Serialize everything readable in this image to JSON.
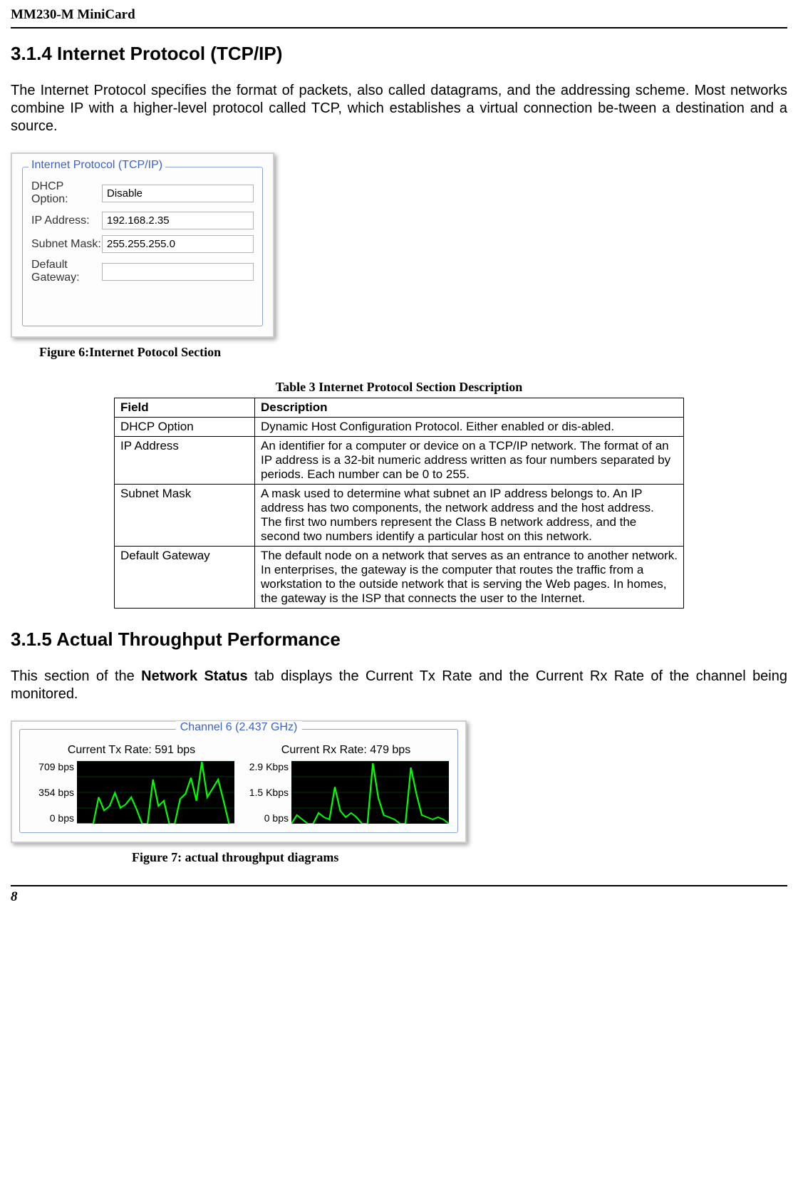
{
  "header": {
    "title": "MM230-M MiniCard"
  },
  "section314": {
    "heading": "3.1.4 Internet Protocol (TCP/IP)",
    "para": "The Internet Protocol specifies the format of packets, also called datagrams, and the addressing scheme. Most networks combine IP with a higher-level protocol called TCP, which establishes a virtual connection be-tween a destination and a source."
  },
  "tcpip_panel": {
    "group_title": "Internet Protocol (TCP/IP)",
    "rows": [
      {
        "label": "DHCP Option:",
        "value": "Disable"
      },
      {
        "label": "IP Address:",
        "value": "192.168.2.35"
      },
      {
        "label": "Subnet Mask:",
        "value": "255.255.255.0"
      },
      {
        "label": "Default Gateway:",
        "value": ""
      }
    ]
  },
  "figure6_caption": "Figure 6:Internet Potocol Section",
  "table3": {
    "caption": "Table 3 Internet Protocol Section Description",
    "headers": [
      "Field",
      "Description"
    ],
    "rows": [
      {
        "field": "DHCP Option",
        "desc": "Dynamic Host Configuration Protocol. Either enabled or dis-abled."
      },
      {
        "field": "IP Address",
        "desc": "An identifier for a computer or device on a TCP/IP network. The format of an IP address\nis a 32-bit numeric address written as four numbers separated by periods. Each number\ncan be 0 to 255."
      },
      {
        "field": "Subnet Mask",
        "desc": "A mask used to determine what subnet an IP address belongs to. An IP address has two\ncomponents, the network address and the host address. The first two numbers represent the Class B network address, and the second two numbers identify a particular host on\nthis network."
      },
      {
        "field": "Default Gateway",
        "desc": "The default node on a network that serves as an entrance to another network. In enterprises, the gateway is the computer that routes the traffic from a workstation to the outside network that is serving the Web pages. In homes, the gateway is the ISP that connects the user to the Internet."
      }
    ]
  },
  "section315": {
    "heading": "3.1.5 Actual Throughput Performance",
    "para_pre": "This section of the ",
    "para_bold": "Network Status",
    "para_post": " tab displays the Current Tx Rate and the Current Rx Rate of the channel being monitored."
  },
  "throughput_panel": {
    "group_title": "Channel 6 (2.437 GHz)",
    "tx": {
      "label": "Current Tx Rate: 591 bps",
      "ticks": [
        "709 bps",
        "354 bps",
        "0 bps"
      ]
    },
    "rx": {
      "label": "Current Rx Rate: 479 bps",
      "ticks": [
        "2.9 Kbps",
        "1.5 Kbps",
        "0 bps"
      ]
    }
  },
  "figure7_caption": "Figure 7: actual throughput diagrams",
  "footer": {
    "page": "8"
  },
  "chart_data": [
    {
      "type": "line",
      "title": "Current Tx Rate: 591 bps",
      "ylabel": "bps",
      "ylim": [
        0,
        709
      ],
      "x": [
        0,
        1,
        2,
        3,
        4,
        5,
        6,
        7,
        8,
        9,
        10,
        11,
        12,
        13,
        14,
        15,
        16,
        17,
        18,
        19,
        20,
        21,
        22,
        23,
        24,
        25,
        26,
        27,
        28,
        29
      ],
      "values": [
        0,
        0,
        0,
        0,
        300,
        150,
        200,
        350,
        180,
        220,
        300,
        160,
        0,
        0,
        500,
        200,
        260,
        0,
        0,
        280,
        340,
        520,
        260,
        700,
        300,
        400,
        500,
        260,
        0,
        0
      ]
    },
    {
      "type": "line",
      "title": "Current Rx Rate: 479 bps",
      "ylabel": "bps",
      "ylim": [
        0,
        2900
      ],
      "x": [
        0,
        1,
        2,
        3,
        4,
        5,
        6,
        7,
        8,
        9,
        10,
        11,
        12,
        13,
        14,
        15,
        16,
        17,
        18,
        19,
        20,
        21,
        22,
        23,
        24,
        25,
        26,
        27,
        28,
        29
      ],
      "values": [
        0,
        400,
        200,
        0,
        0,
        500,
        300,
        200,
        1700,
        600,
        300,
        500,
        300,
        0,
        0,
        2800,
        1200,
        400,
        300,
        200,
        0,
        0,
        2600,
        1400,
        400,
        300,
        200,
        300,
        200,
        0
      ]
    }
  ]
}
